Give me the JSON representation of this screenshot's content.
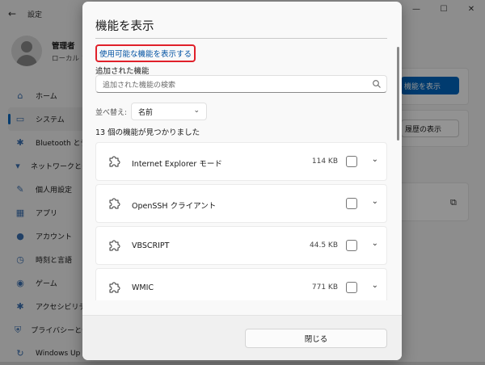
{
  "settings": {
    "title": "設定",
    "window_controls": [
      "—",
      "☐",
      "✕"
    ],
    "user": {
      "name": "管理者",
      "account": "ローカル アカ"
    },
    "nav": [
      {
        "label": "ホーム",
        "icon": "home-icon",
        "active": false
      },
      {
        "label": "システム",
        "icon": "system-icon",
        "active": true
      },
      {
        "label": "Bluetooth とデ",
        "icon": "bluetooth-icon",
        "active": false
      },
      {
        "label": "ネットワークとイ",
        "icon": "network-icon",
        "active": false
      },
      {
        "label": "個人用設定",
        "icon": "personalization-icon",
        "active": false
      },
      {
        "label": "アプリ",
        "icon": "apps-icon",
        "active": false
      },
      {
        "label": "アカウント",
        "icon": "accounts-icon",
        "active": false
      },
      {
        "label": "時刻と言語",
        "icon": "time-language-icon",
        "active": false
      },
      {
        "label": "ゲーム",
        "icon": "gaming-icon",
        "active": false
      },
      {
        "label": "アクセシビリテ",
        "icon": "accessibility-icon",
        "active": false
      },
      {
        "label": "プライバシーとセ",
        "icon": "privacy-icon",
        "active": false
      },
      {
        "label": "Windows Up",
        "icon": "windows-update-icon",
        "active": false
      }
    ],
    "view_features_button": "機能を表示",
    "history_button": "履歴の表示"
  },
  "dialog": {
    "title": "機能を表示",
    "available_link": "使用可能な機能を表示する",
    "added_label": "追加された機能",
    "search_placeholder": "追加された機能の検索",
    "sort_label": "並べ替え:",
    "sort_value": "名前",
    "count_text": "13 個の機能が見つかりました",
    "features": [
      {
        "name": "Internet Explorer モード",
        "size": "114 KB"
      },
      {
        "name": "OpenSSH クライアント",
        "size": ""
      },
      {
        "name": "VBSCRIPT",
        "size": "44.5 KB"
      },
      {
        "name": "WMIC",
        "size": "771 KB"
      }
    ],
    "close_button": "閉じる"
  },
  "colors": {
    "accent": "#0067c0",
    "highlight_box": "#e0202a",
    "link": "#0052a3"
  }
}
